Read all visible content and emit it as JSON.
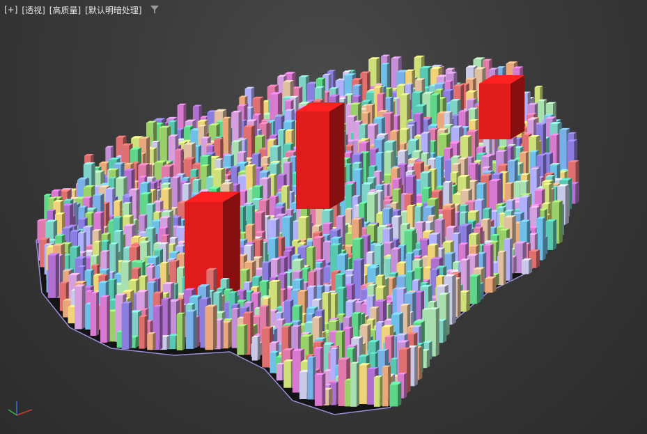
{
  "viewport": {
    "menus": [
      {
        "label": "[+]"
      },
      {
        "label": "[透视]"
      },
      {
        "label": "[高质量]"
      },
      {
        "label": "[默认明暗处理]"
      }
    ],
    "filter_icon": "filter-icon"
  },
  "scene": {
    "background": "#3b3b3b",
    "base_outline_color": "#9b8fd8",
    "highlight_color": "#e01b1b",
    "palette": [
      "#7fd3c6",
      "#c58fd8",
      "#9ad06a",
      "#e8a87c",
      "#8c7ee0",
      "#e07aa8",
      "#cfe07a",
      "#6fc0e8",
      "#f0d27a",
      "#b06fd1",
      "#5fd68a",
      "#e06f6f",
      "#c9c9e8",
      "#d6a0e0",
      "#7ab0e8",
      "#a8e0b0",
      "#e0c0a0",
      "#58c8b0",
      "#d87ad0",
      "#b0b0ff"
    ]
  },
  "gizmo": {
    "x_color": "#d23a3a",
    "y_color": "#39b54a",
    "z_color": "#3a6fd8"
  }
}
